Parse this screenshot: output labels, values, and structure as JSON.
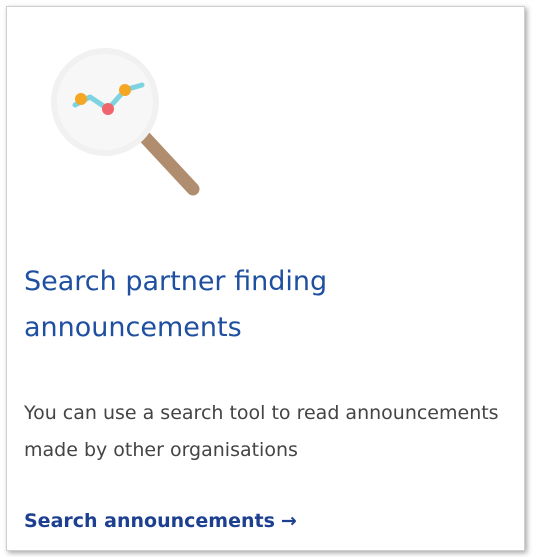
{
  "card": {
    "title": "Search partner finding announcements",
    "description": "You can use a search tool to read announcements made by other organisations",
    "link_label": "Search announcements",
    "link_arrow": "→"
  },
  "icons": {
    "illustration": "magnifying-glass-chart-icon"
  },
  "colors": {
    "title": "#1f4fa0",
    "link": "#1c3f8f",
    "text": "#444444",
    "chart_line": "#7dd3e0",
    "chart_point_orange": "#f5a623",
    "chart_point_red": "#f0646b",
    "handle": "#b08d6e"
  }
}
